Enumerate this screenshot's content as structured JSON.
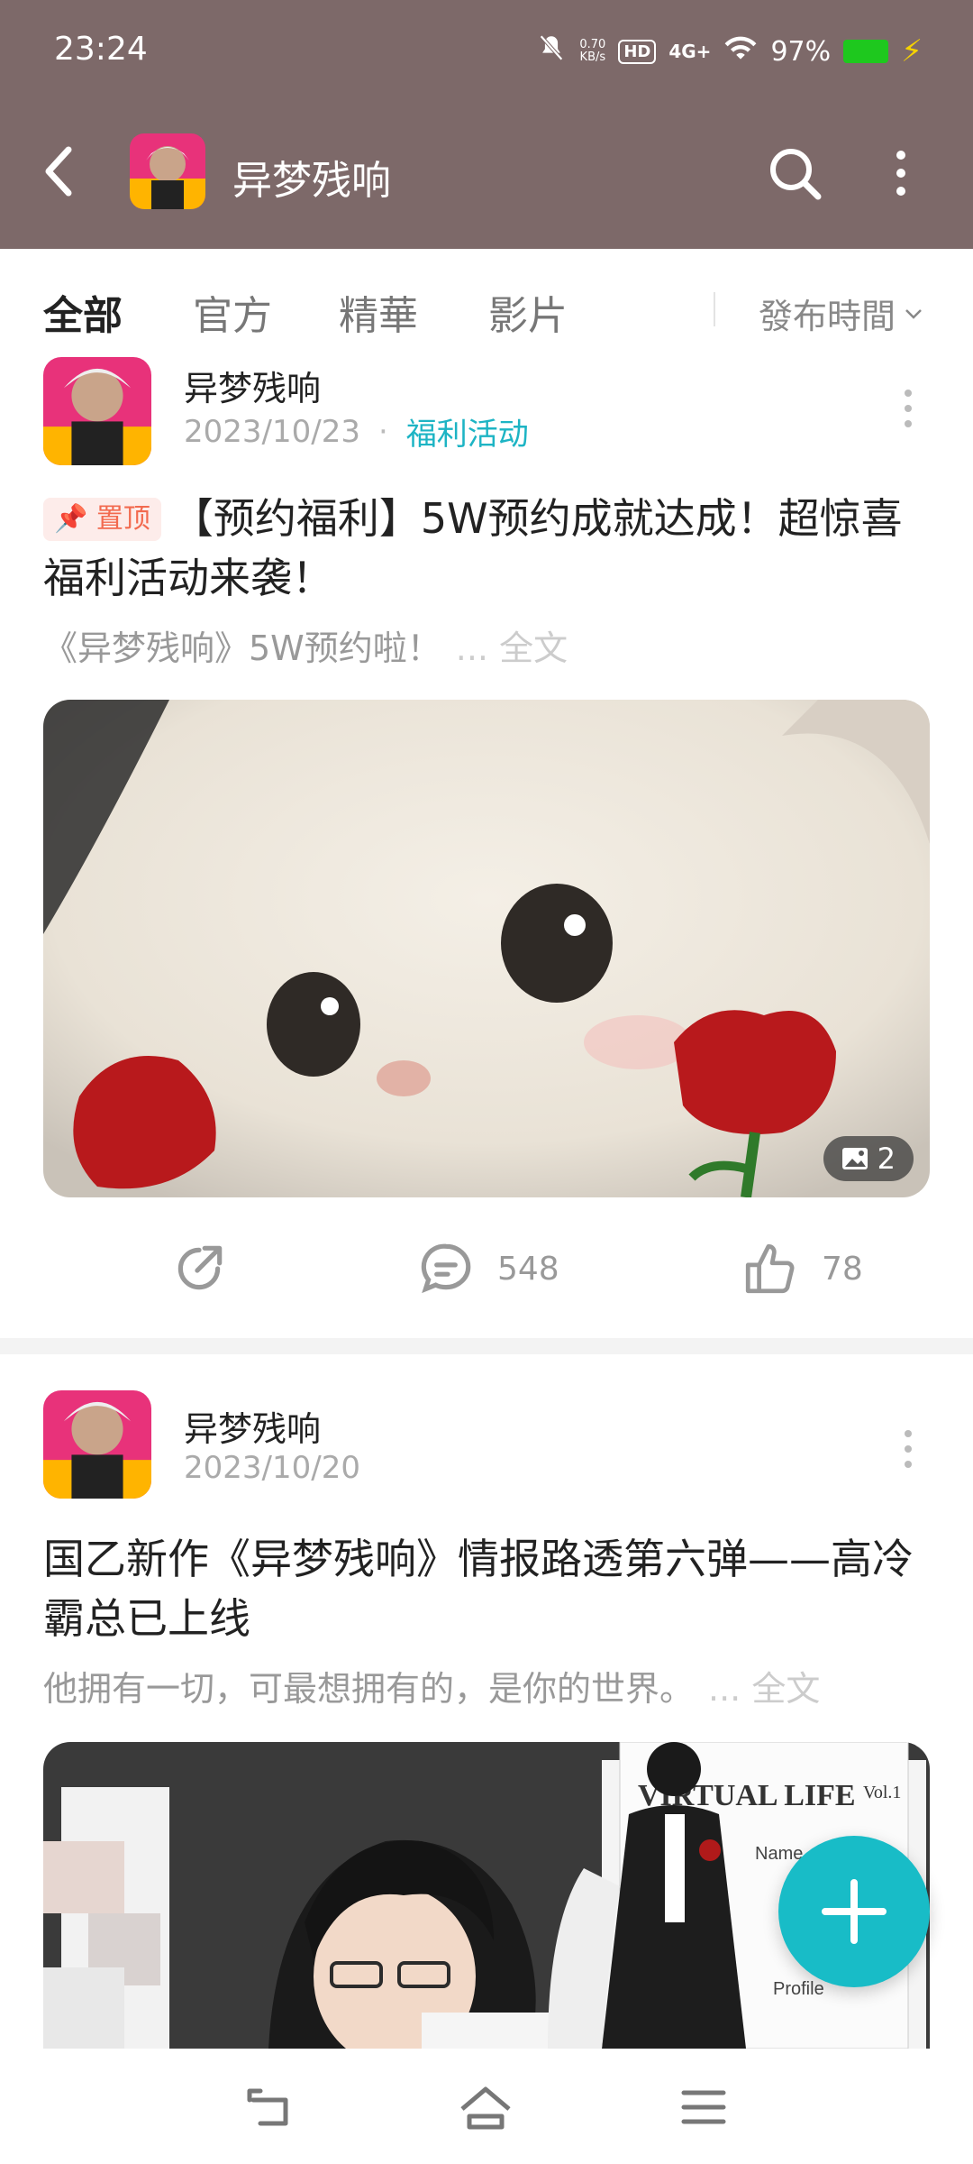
{
  "status_bar": {
    "time": "23:24",
    "net_speed_value": "0.70",
    "net_speed_unit": "KB/s",
    "hd_badge": "HD",
    "signal": "4G+",
    "battery": "97%"
  },
  "header": {
    "title": "异梦残响"
  },
  "tabs": [
    {
      "label": "全部",
      "active": true
    },
    {
      "label": "官方",
      "active": false
    },
    {
      "label": "精華",
      "active": false
    },
    {
      "label": "影片",
      "active": false
    }
  ],
  "sort": {
    "label": "發布時間"
  },
  "posts": [
    {
      "author": "异梦残响",
      "date": "2023/10/23",
      "tag": "福利活动",
      "pin_label": "置顶",
      "title": "【预约福利】5W预约成就达成！超惊喜福利活动来袭！",
      "summary": "《异梦残响》5W预约啦！",
      "more": "... 全文",
      "image_count": "2",
      "comments": "548",
      "likes": "78"
    },
    {
      "author": "异梦残响",
      "date": "2023/10/20",
      "title": "国乙新作《异梦残响》情报路透第六弹——高冷霸总已上线",
      "summary": "他拥有一切，可最想拥有的，是你的世界。",
      "more": "... 全文",
      "image_text_1": "VIRTUAL LIFE",
      "image_text_2": "Vol.1",
      "image_text_3": "Name",
      "image_text_4": "Profile"
    }
  ],
  "colors": {
    "header_bg": "#7d6969",
    "accent": "#18bcc7",
    "pin": "#f26a4f"
  }
}
